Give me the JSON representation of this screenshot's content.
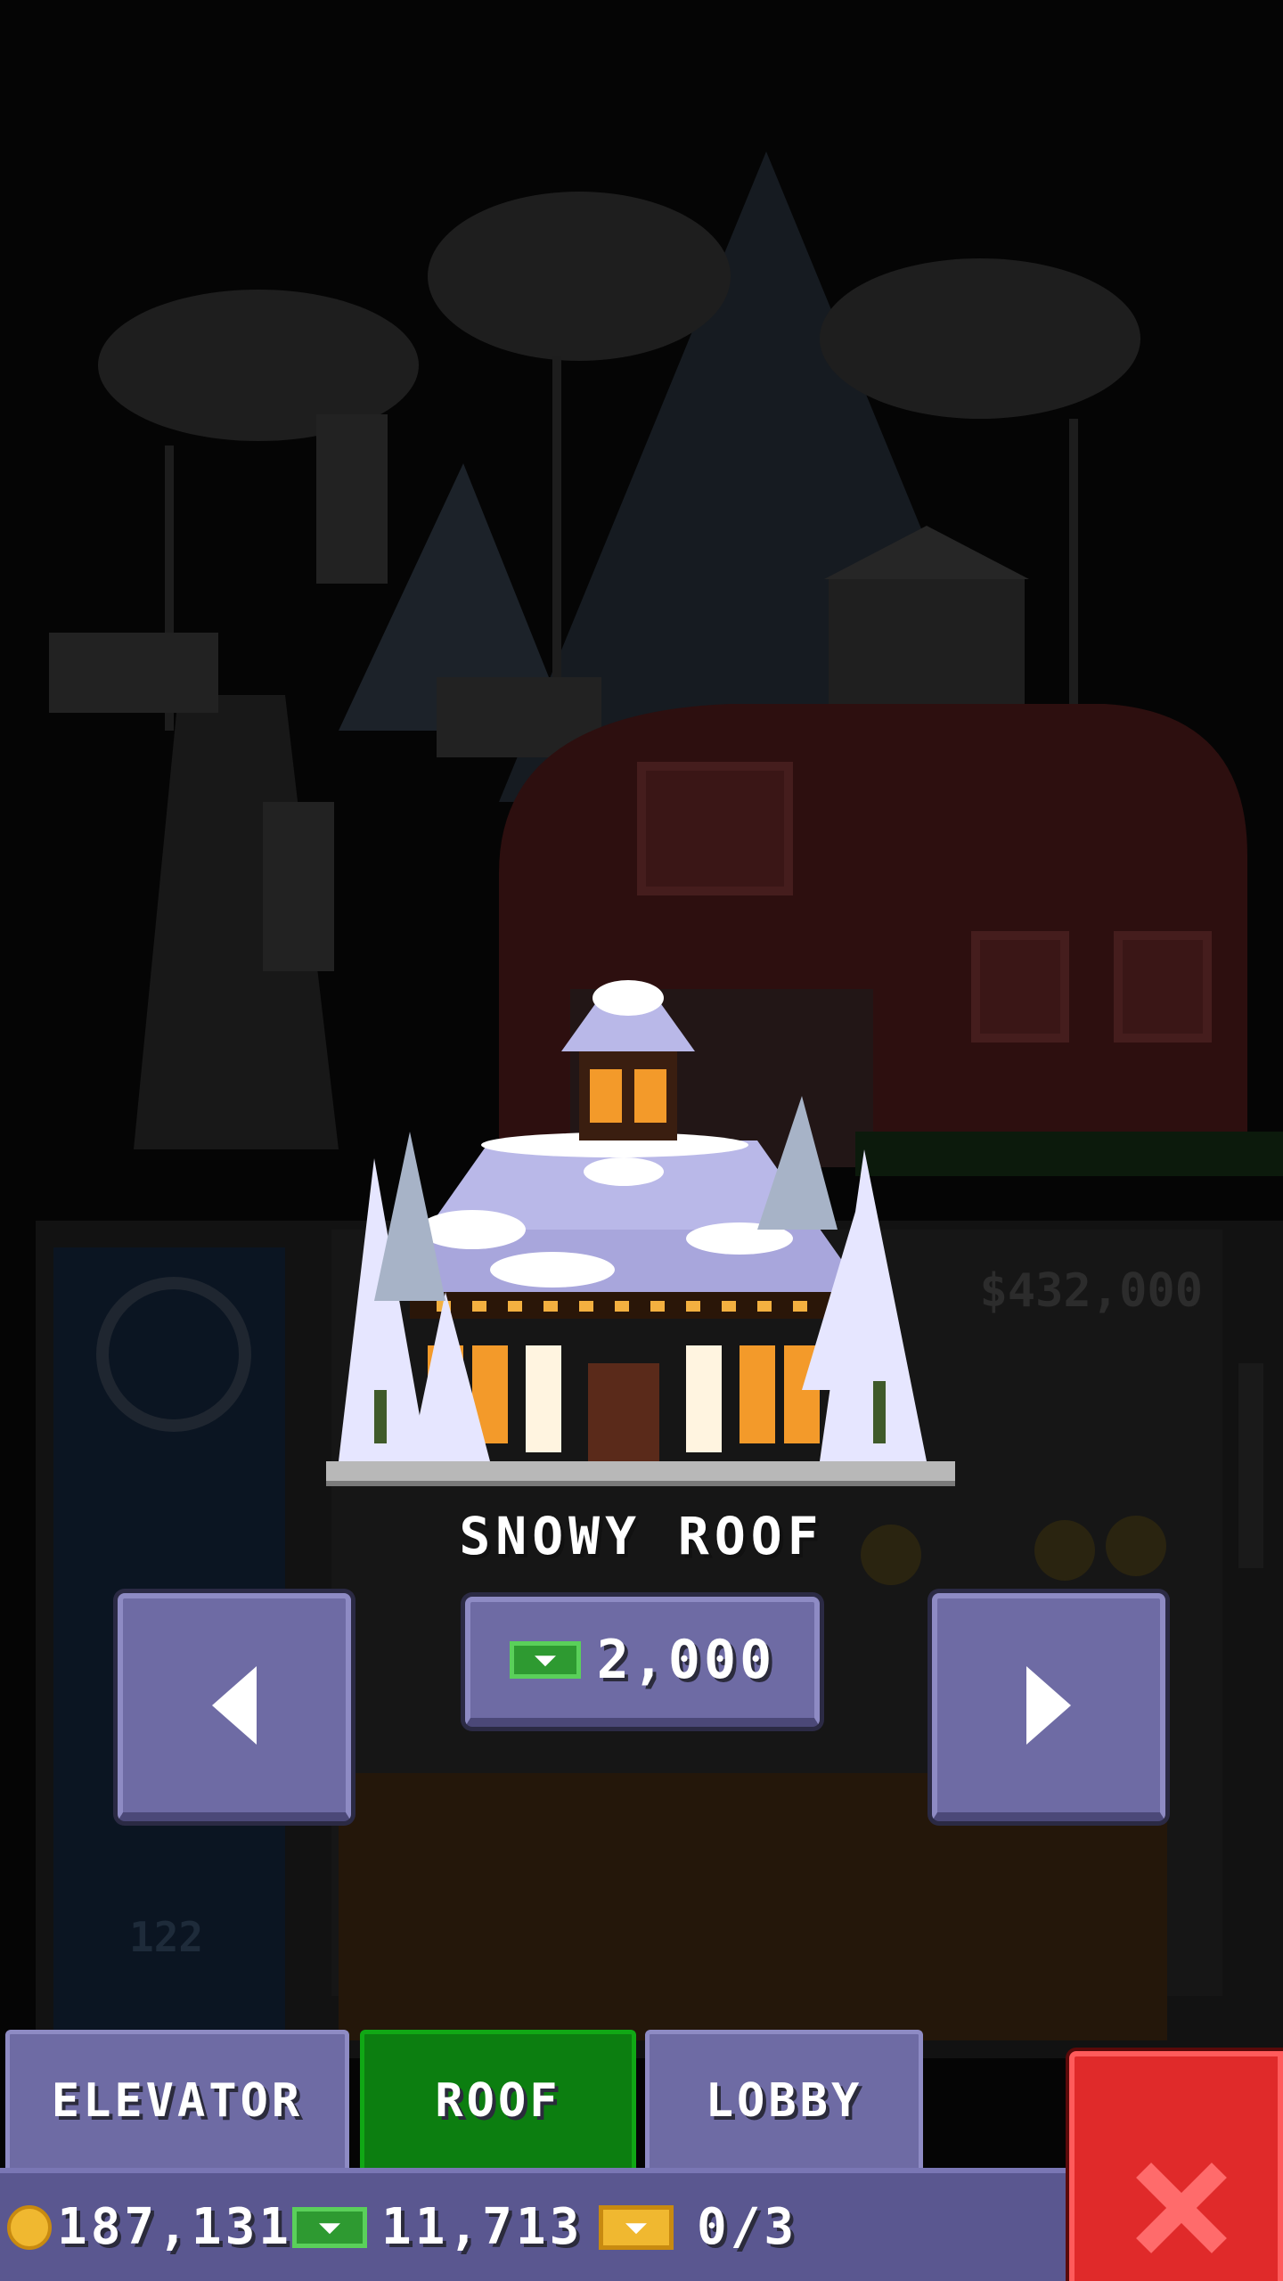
{
  "item": {
    "name": "SNOWY ROOF",
    "price": "2,000",
    "price_currency_icon": "bux-icon"
  },
  "navigation": {
    "prev_icon": "arrow-left-icon",
    "next_icon": "arrow-right-icon"
  },
  "tabs": [
    {
      "label": "ELEVATOR",
      "active": false
    },
    {
      "label": "ROOF",
      "active": true
    },
    {
      "label": "LOBBY",
      "active": false
    }
  ],
  "status": {
    "coins": "187,131",
    "bux": "11,713",
    "tickets": "0/3"
  },
  "background_labels": {
    "floor_price": "$432,000",
    "floor_number": "122"
  },
  "colors": {
    "button": "#6e6ba4",
    "active_tab": "#0c7e10",
    "close": "#e02a2a"
  }
}
